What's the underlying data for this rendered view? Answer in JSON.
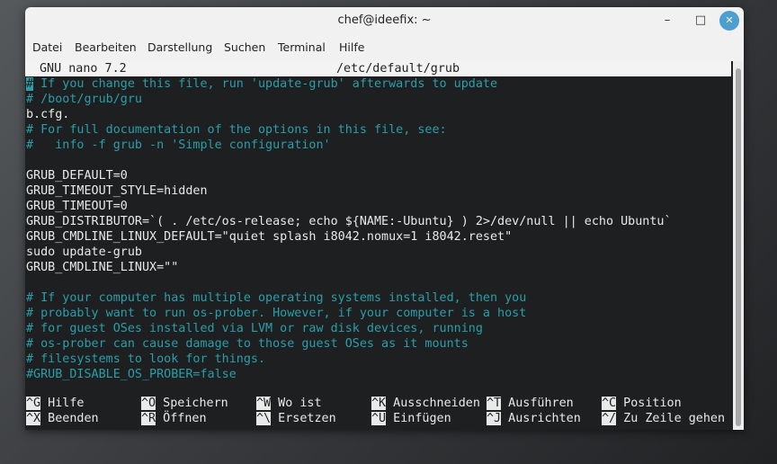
{
  "window": {
    "title": "chef@ideefix: ~",
    "buttons": {
      "minimize": "–",
      "maximize": "□",
      "close": "✕"
    }
  },
  "menu": [
    "Datei",
    "Bearbeiten",
    "Darstellung",
    "Suchen",
    "Terminal",
    "Hilfe"
  ],
  "nano": {
    "version": "GNU nano 7.2",
    "filename": "/etc/default/grub",
    "first_line_rest": " If you change this file, run 'update-grub' afterwards to update",
    "lines": [
      {
        "text": "# /boot/grub/gru",
        "comment": true
      },
      {
        "text": "b.cfg.",
        "comment": false
      },
      {
        "text": "# For full documentation of the options in this file, see:",
        "comment": true
      },
      {
        "text": "#   info -f grub -n 'Simple configuration'",
        "comment": true
      },
      {
        "text": "",
        "comment": false
      },
      {
        "text": "GRUB_DEFAULT=0",
        "comment": false
      },
      {
        "text": "GRUB_TIMEOUT_STYLE=hidden",
        "comment": false
      },
      {
        "text": "GRUB_TIMEOUT=0",
        "comment": false
      },
      {
        "text": "GRUB_DISTRIBUTOR=`( . /etc/os-release; echo ${NAME:-Ubuntu} ) 2>/dev/null || echo Ubuntu`",
        "comment": false
      },
      {
        "text": "GRUB_CMDLINE_LINUX_DEFAULT=\"quiet splash i8042.nomux=1 i8042.reset\"",
        "comment": false
      },
      {
        "text": "sudo update-grub",
        "comment": false
      },
      {
        "text": "GRUB_CMDLINE_LINUX=\"\"",
        "comment": false
      },
      {
        "text": "",
        "comment": false
      },
      {
        "text": "# If your computer has multiple operating systems installed, then you",
        "comment": true
      },
      {
        "text": "# probably want to run os-prober. However, if your computer is a host",
        "comment": true
      },
      {
        "text": "# for guest OSes installed via LVM or raw disk devices, running",
        "comment": true
      },
      {
        "text": "# os-prober can cause damage to those guest OSes as it mounts",
        "comment": true
      },
      {
        "text": "# filesystems to look for things.",
        "comment": true
      },
      {
        "text": "#GRUB_DISABLE_OS_PROBER=false",
        "comment": true
      }
    ],
    "shortcuts": [
      {
        "key": "^G",
        "label": "Hilfe"
      },
      {
        "key": "^O",
        "label": "Speichern"
      },
      {
        "key": "^W",
        "label": "Wo ist"
      },
      {
        "key": "^K",
        "label": "Ausschneiden"
      },
      {
        "key": "^T",
        "label": "Ausführen"
      },
      {
        "key": "^C",
        "label": "Position"
      },
      {
        "key": "^X",
        "label": "Beenden"
      },
      {
        "key": "^R",
        "label": "Öffnen"
      },
      {
        "key": "^\\",
        "label": "Ersetzen"
      },
      {
        "key": "^U",
        "label": "Einfügen"
      },
      {
        "key": "^J",
        "label": "Ausrichten"
      },
      {
        "key": "^/",
        "label": "Zu Zeile gehen"
      }
    ]
  }
}
